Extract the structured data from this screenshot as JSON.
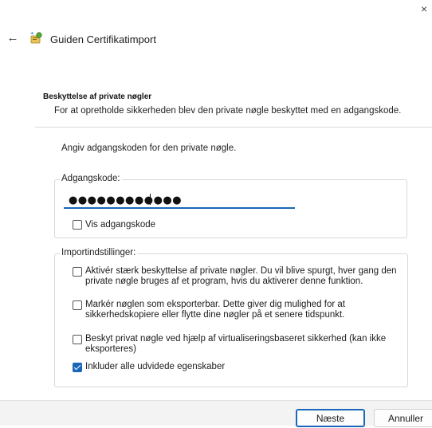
{
  "window": {
    "close_glyph": "×",
    "back_glyph": "←",
    "title": "Guiden Certifikatimport"
  },
  "header": {
    "heading": "Beskyttelse af private nøgler",
    "description": "For at opretholde sikkerheden blev den private nøgle beskyttet med en adgangskode."
  },
  "body": {
    "intro": "Angiv adgangskoden for den private nøgle."
  },
  "password_group": {
    "legend": "Adgangskode:",
    "masked_value": "●●●●●●●●●●●●",
    "show_password": {
      "label": "Vis adgangskode",
      "checked": false
    }
  },
  "import_group": {
    "legend": "Importindstillinger:",
    "options": [
      {
        "label_line1": "Aktivér stærk beskyttelse af private nøgler. Du vil blive spurgt, hver gang den",
        "label_line2": "private nøgle bruges af et program, hvis du aktiverer denne funktion.",
        "checked": false
      },
      {
        "label_line1": "Markér nøglen som eksporterbar. Dette giver dig mulighed for at",
        "label_line2": "sikkerhedskopiere eller flytte dine nøgler på et senere tidspunkt.",
        "checked": false
      },
      {
        "label_line1": "Beskyt privat nøgle ved hjælp af virtualiseringsbaseret sikkerhed (kan ikke",
        "label_line2": "eksporteres)",
        "checked": false
      },
      {
        "label_line1": "Inkluder alle udvidede egenskaber",
        "label_line2": "",
        "checked": true
      }
    ]
  },
  "footer": {
    "next_label": "Næste",
    "cancel_label": "Annuller"
  },
  "colors": {
    "accent": "#1a66b8",
    "footer_bg": "#f3f3f3"
  },
  "icons": {
    "wizard": "certificate-wizard-icon",
    "back": "arrow-left-icon",
    "close": "close-icon"
  }
}
